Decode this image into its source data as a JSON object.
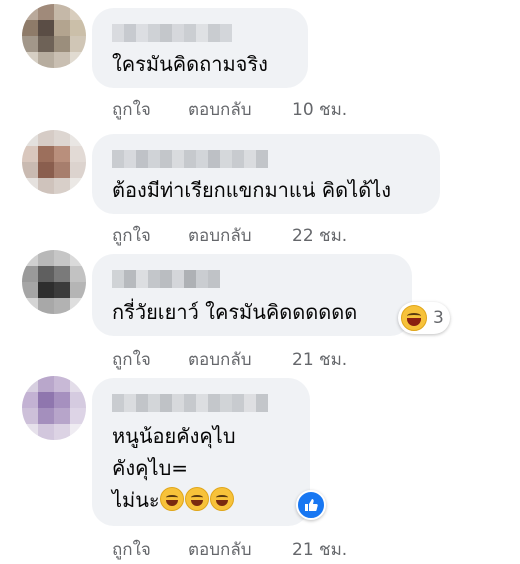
{
  "comments": [
    {
      "text_lines": [
        "ใครมันคิดถามจริง"
      ],
      "like_label": "ถูกใจ",
      "reply_label": "ตอบกลับ",
      "time": "10 ชม."
    },
    {
      "text_lines": [
        "ต้องมีท่าเรียกแขกมาแน่ คิดได้ไง"
      ],
      "like_label": "ถูกใจ",
      "reply_label": "ตอบกลับ",
      "time": "22 ชม."
    },
    {
      "text_lines": [
        "กรี่วัยเยาว์ ใครมันคิดดดดดด"
      ],
      "like_label": "ถูกใจ",
      "reply_label": "ตอบกลับ",
      "time": "21 ชม.",
      "reaction": {
        "icon": "laughing-emoji-icon",
        "count": "3"
      }
    },
    {
      "text_lines": [
        "หนูน้อยคังคุไบ",
        "คังคุไบ=",
        "ไม่นะ"
      ],
      "like_label": "ถูกใจ",
      "reply_label": "ตอบกลับ",
      "time": "21 ชม.",
      "reaction": {
        "icon": "like-thumb-icon",
        "count": ""
      }
    }
  ],
  "colors": {
    "bubble": "#f0f2f5",
    "meta_text": "#65676b",
    "like_blue": "#1877f2"
  }
}
